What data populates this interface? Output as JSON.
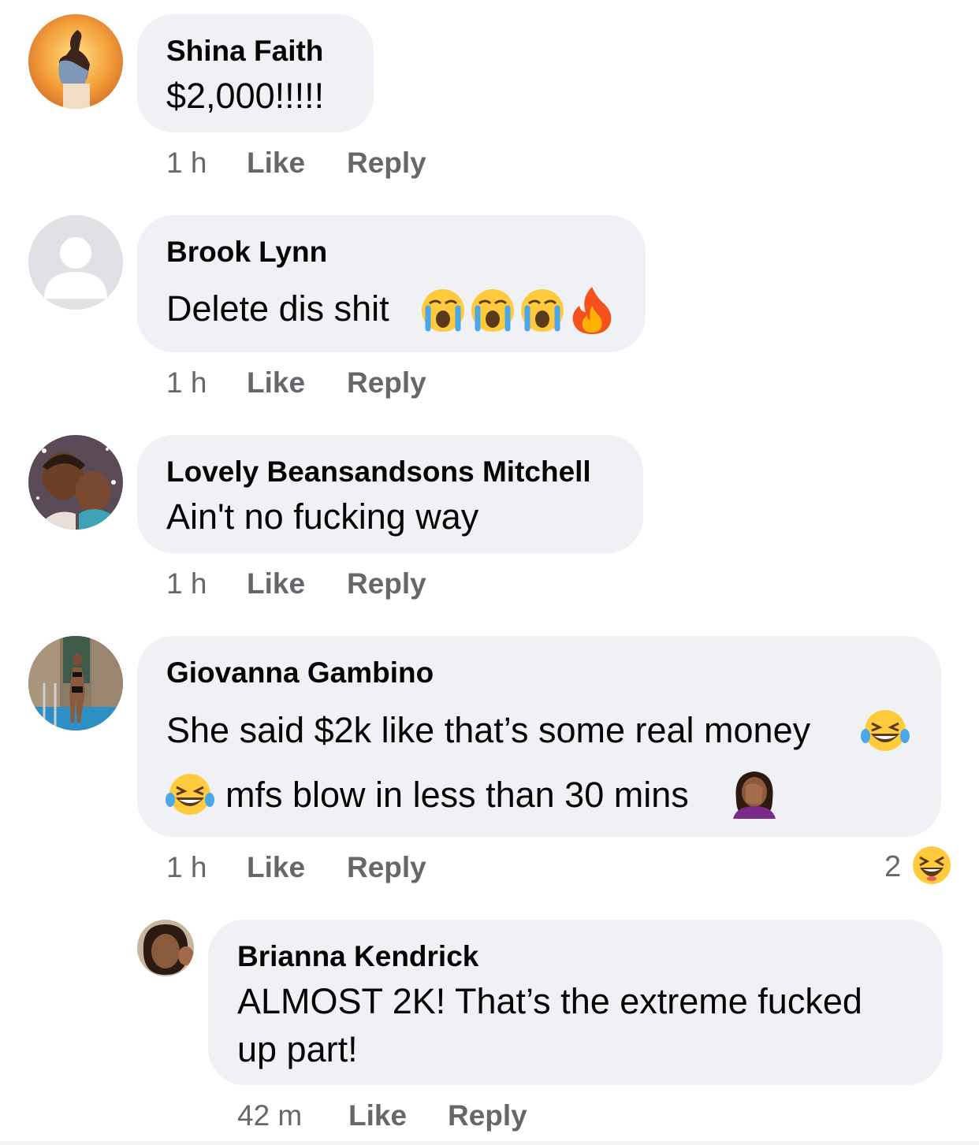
{
  "accent": "#f0f1f4",
  "meta_color": "#65676b",
  "comments": [
    {
      "author": "Shina Faith",
      "text": "$2,000!!!!!",
      "time": "1 h",
      "like": "Like",
      "reply": "Reply",
      "avatar": "sunset-photo"
    },
    {
      "author": "Brook Lynn",
      "text": "Delete dis shit",
      "emojis": [
        "loudly-crying-face-icon",
        "loudly-crying-face-icon",
        "loudly-crying-face-icon",
        "fire-icon"
      ],
      "time": "1 h",
      "like": "Like",
      "reply": "Reply",
      "avatar": "default-user-silhouette"
    },
    {
      "author": "Lovely Beansandsons Mitchell",
      "text": "Ain't no fucking way",
      "time": "1 h",
      "like": "Like",
      "reply": "Reply",
      "avatar": "mother-and-child-photo"
    },
    {
      "author": "Giovanna Gambino",
      "text_line1": "She said $2k like that’s some real money",
      "text_line2": "mfs blow in less than 30 mins",
      "emojis": [
        "tears-of-joy-icon",
        "tears-of-joy-icon",
        "facepalm-icon"
      ],
      "time": "1 h",
      "like": "Like",
      "reply": "Reply",
      "reaction_count": "2",
      "reaction_icon": "laughing-squinting-face-icon",
      "avatar": "pool-photo"
    }
  ],
  "reply": {
    "author": "Brianna Kendrick",
    "text_line1": "ALMOST 2K! That’s the extreme fucked",
    "text_line2": "up part!",
    "time": "42 m",
    "like": "Like",
    "reply": "Reply",
    "avatar": "selfie-photo"
  }
}
